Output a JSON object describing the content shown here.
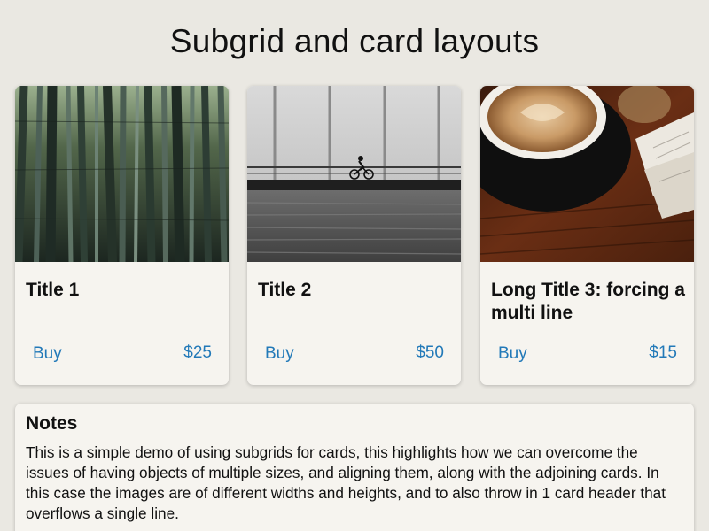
{
  "page": {
    "title": "Subgrid and card layouts"
  },
  "cards": [
    {
      "image": "bamboo-forest-photo",
      "title": "Title 1",
      "buy_label": "Buy",
      "price": "$25"
    },
    {
      "image": "cyclist-on-bridge-photo",
      "title": "Title 2",
      "buy_label": "Buy",
      "price": "$50"
    },
    {
      "image": "coffee-cup-photo",
      "title": "Long Title 3: forcing a multi line",
      "buy_label": "Buy",
      "price": "$15"
    }
  ],
  "notes": {
    "heading": "Notes",
    "text": "This is a simple demo of using subgrids for cards, this highlights how we can overcome the issues of having objects of multiple sizes, and aligning them, along with the adjoining cards. In this case the images are of different widths and heights, and to also throw in 1 card header that overflows a single line."
  },
  "colors": {
    "background": "#eae8e2",
    "card": "#f6f4ef",
    "link": "#2279b8"
  }
}
